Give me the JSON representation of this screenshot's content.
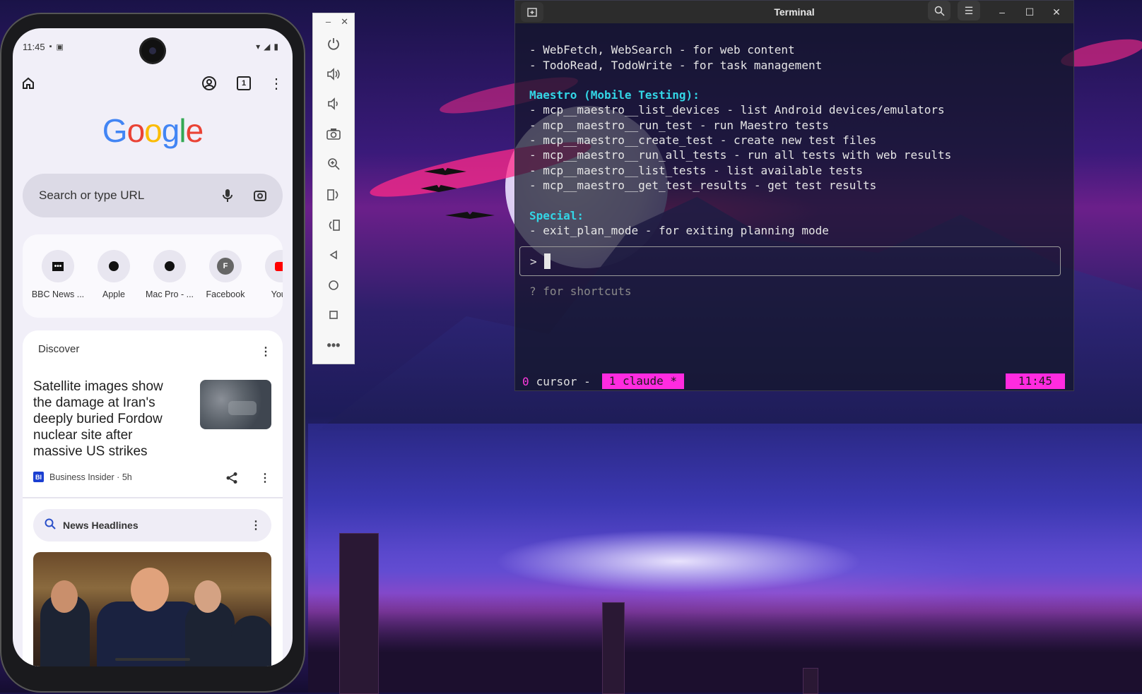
{
  "phone": {
    "status_time": "11:45",
    "search_placeholder": "Search or type URL",
    "tab_count": "1",
    "google_logo": "Google",
    "shortcuts": [
      {
        "label": "BBC News ...",
        "icon": "•••"
      },
      {
        "label": "Apple",
        "icon": ""
      },
      {
        "label": "Mac Pro - ...",
        "icon": ""
      },
      {
        "label": "Facebook",
        "icon": "F"
      },
      {
        "label": "YouT",
        "icon": ""
      }
    ],
    "discover_title": "Discover",
    "article": {
      "headline": "Satellite images show the damage at Iran's deeply buried Fordow nuclear site after massive US strikes",
      "source": "Business Insider · 5h",
      "source_logo": "BI"
    },
    "news_headlines": "News Headlines",
    "colors": {
      "google_blue": "#4285F4",
      "google_red": "#EA4335",
      "google_yellow": "#FBBC05",
      "google_green": "#34A853"
    }
  },
  "emulator": {
    "minimize": "–",
    "close": "✕",
    "icons": [
      "power-icon",
      "volume-up-icon",
      "volume-down-icon",
      "camera-icon",
      "zoom-icon",
      "rotate-left-icon",
      "rotate-right-icon",
      "back-icon",
      "home-icon",
      "overview-icon",
      "more-icon"
    ]
  },
  "terminal": {
    "title": "Terminal",
    "lines_top": [
      "- WebFetch, WebSearch - for web content",
      "- TodoRead, TodoWrite - for task management"
    ],
    "maestro_header": "Maestro (Mobile Testing):",
    "maestro_lines": [
      "- mcp__maestro__list_devices - list Android devices/emulators",
      "- mcp__maestro__run_test - run Maestro tests",
      "- mcp__maestro__create_test - create new test files",
      "- mcp__maestro__run_all_tests - run all tests with web results",
      "- mcp__maestro__list_tests - list available tests",
      "- mcp__maestro__get_test_results - get test results"
    ],
    "special_header": "Special:",
    "special_lines": [
      "- exit_plan_mode - for exiting planning mode"
    ],
    "prompt_symbol": ">",
    "hint": "? for shortcuts",
    "status": {
      "window0_index": "0",
      "window0": "cursor -",
      "window1": "1 claude *",
      "clock": "11:45"
    },
    "colors": {
      "header": "#33d6e6",
      "status_accent": "#ff2be0"
    }
  }
}
